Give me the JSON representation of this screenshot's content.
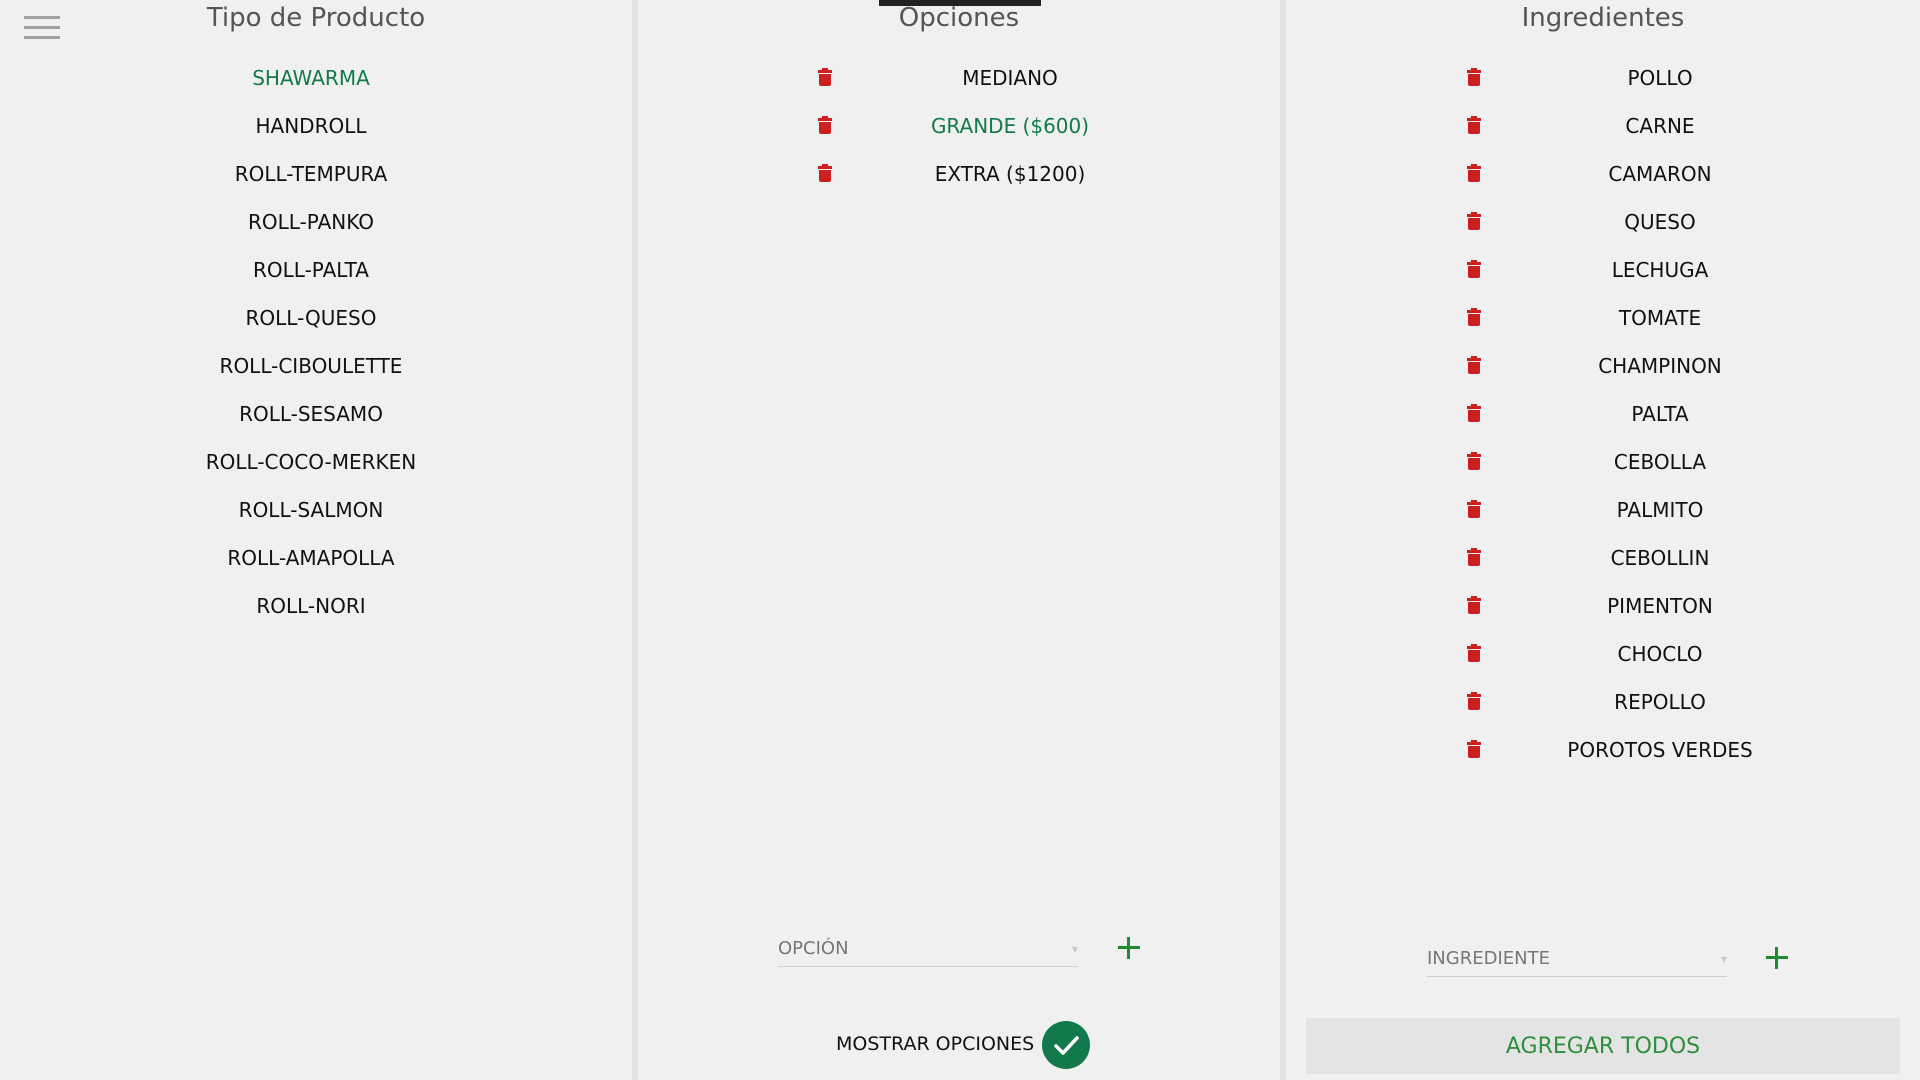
{
  "productos": {
    "title": "Tipo de Producto",
    "items": [
      "SHAWARMA",
      "HANDROLL",
      "ROLL-TEMPURA",
      "ROLL-PANKO",
      "ROLL-PALTA",
      "ROLL-QUESO",
      "ROLL-CIBOULETTE",
      "ROLL-SESAMO",
      "ROLL-COCO-MERKEN",
      "ROLL-SALMON",
      "ROLL-AMAPOLLA",
      "ROLL-NORI"
    ],
    "selected": "SHAWARMA"
  },
  "opciones": {
    "title": "Opciones",
    "items": [
      "MEDIANO",
      "GRANDE ($600)",
      "EXTRA ($1200)"
    ],
    "selected": "GRANDE ($600)",
    "input_placeholder": "OPCIÓN",
    "mostrar_label": "MOSTRAR OPCIONES",
    "mostrar_checked": true
  },
  "ingredientes": {
    "title": "Ingredientes",
    "items": [
      "POLLO",
      "CARNE",
      "CAMARON",
      "QUESO",
      "LECHUGA",
      "TOMATE",
      "CHAMPINON",
      "PALTA",
      "CEBOLLA",
      "PALMITO",
      "CEBOLLIN",
      "PIMENTON",
      "CHOCLO",
      "REPOLLO",
      "POROTOS VERDES"
    ],
    "input_placeholder": "INGREDIENTE",
    "agregar_todos_label": "AGREGAR TODOS"
  },
  "colors": {
    "selected_text": "#127a4a",
    "trash": "#cc1f1f",
    "plus": "#1f8a2e",
    "check_bg": "#127a4a"
  },
  "icons": {
    "menu": "hamburger-menu-icon",
    "delete": "trash-icon",
    "add": "plus-icon",
    "check": "check-icon",
    "dropdown": "chevron-down-icon"
  }
}
